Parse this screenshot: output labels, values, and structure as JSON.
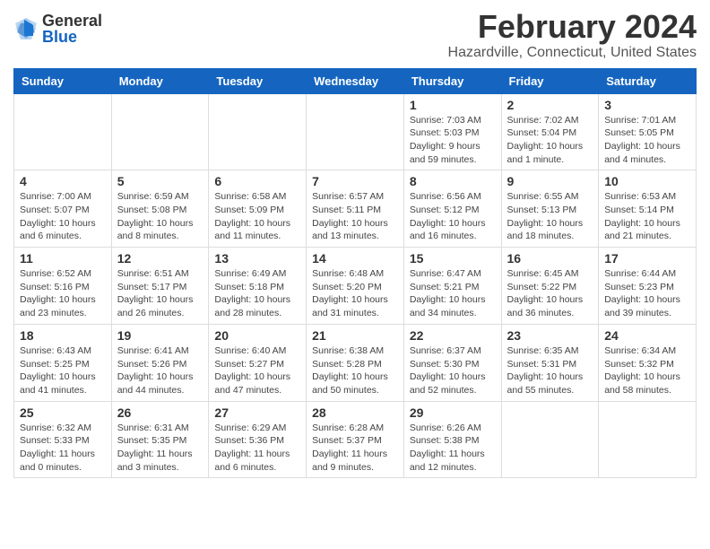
{
  "logo": {
    "general": "General",
    "blue": "Blue"
  },
  "title": "February 2024",
  "location": "Hazardville, Connecticut, United States",
  "days_of_week": [
    "Sunday",
    "Monday",
    "Tuesday",
    "Wednesday",
    "Thursday",
    "Friday",
    "Saturday"
  ],
  "weeks": [
    [
      {
        "day": "",
        "info": ""
      },
      {
        "day": "",
        "info": ""
      },
      {
        "day": "",
        "info": ""
      },
      {
        "day": "",
        "info": ""
      },
      {
        "day": "1",
        "info": "Sunrise: 7:03 AM\nSunset: 5:03 PM\nDaylight: 9 hours\nand 59 minutes."
      },
      {
        "day": "2",
        "info": "Sunrise: 7:02 AM\nSunset: 5:04 PM\nDaylight: 10 hours\nand 1 minute."
      },
      {
        "day": "3",
        "info": "Sunrise: 7:01 AM\nSunset: 5:05 PM\nDaylight: 10 hours\nand 4 minutes."
      }
    ],
    [
      {
        "day": "4",
        "info": "Sunrise: 7:00 AM\nSunset: 5:07 PM\nDaylight: 10 hours\nand 6 minutes."
      },
      {
        "day": "5",
        "info": "Sunrise: 6:59 AM\nSunset: 5:08 PM\nDaylight: 10 hours\nand 8 minutes."
      },
      {
        "day": "6",
        "info": "Sunrise: 6:58 AM\nSunset: 5:09 PM\nDaylight: 10 hours\nand 11 minutes."
      },
      {
        "day": "7",
        "info": "Sunrise: 6:57 AM\nSunset: 5:11 PM\nDaylight: 10 hours\nand 13 minutes."
      },
      {
        "day": "8",
        "info": "Sunrise: 6:56 AM\nSunset: 5:12 PM\nDaylight: 10 hours\nand 16 minutes."
      },
      {
        "day": "9",
        "info": "Sunrise: 6:55 AM\nSunset: 5:13 PM\nDaylight: 10 hours\nand 18 minutes."
      },
      {
        "day": "10",
        "info": "Sunrise: 6:53 AM\nSunset: 5:14 PM\nDaylight: 10 hours\nand 21 minutes."
      }
    ],
    [
      {
        "day": "11",
        "info": "Sunrise: 6:52 AM\nSunset: 5:16 PM\nDaylight: 10 hours\nand 23 minutes."
      },
      {
        "day": "12",
        "info": "Sunrise: 6:51 AM\nSunset: 5:17 PM\nDaylight: 10 hours\nand 26 minutes."
      },
      {
        "day": "13",
        "info": "Sunrise: 6:49 AM\nSunset: 5:18 PM\nDaylight: 10 hours\nand 28 minutes."
      },
      {
        "day": "14",
        "info": "Sunrise: 6:48 AM\nSunset: 5:20 PM\nDaylight: 10 hours\nand 31 minutes."
      },
      {
        "day": "15",
        "info": "Sunrise: 6:47 AM\nSunset: 5:21 PM\nDaylight: 10 hours\nand 34 minutes."
      },
      {
        "day": "16",
        "info": "Sunrise: 6:45 AM\nSunset: 5:22 PM\nDaylight: 10 hours\nand 36 minutes."
      },
      {
        "day": "17",
        "info": "Sunrise: 6:44 AM\nSunset: 5:23 PM\nDaylight: 10 hours\nand 39 minutes."
      }
    ],
    [
      {
        "day": "18",
        "info": "Sunrise: 6:43 AM\nSunset: 5:25 PM\nDaylight: 10 hours\nand 41 minutes."
      },
      {
        "day": "19",
        "info": "Sunrise: 6:41 AM\nSunset: 5:26 PM\nDaylight: 10 hours\nand 44 minutes."
      },
      {
        "day": "20",
        "info": "Sunrise: 6:40 AM\nSunset: 5:27 PM\nDaylight: 10 hours\nand 47 minutes."
      },
      {
        "day": "21",
        "info": "Sunrise: 6:38 AM\nSunset: 5:28 PM\nDaylight: 10 hours\nand 50 minutes."
      },
      {
        "day": "22",
        "info": "Sunrise: 6:37 AM\nSunset: 5:30 PM\nDaylight: 10 hours\nand 52 minutes."
      },
      {
        "day": "23",
        "info": "Sunrise: 6:35 AM\nSunset: 5:31 PM\nDaylight: 10 hours\nand 55 minutes."
      },
      {
        "day": "24",
        "info": "Sunrise: 6:34 AM\nSunset: 5:32 PM\nDaylight: 10 hours\nand 58 minutes."
      }
    ],
    [
      {
        "day": "25",
        "info": "Sunrise: 6:32 AM\nSunset: 5:33 PM\nDaylight: 11 hours\nand 0 minutes."
      },
      {
        "day": "26",
        "info": "Sunrise: 6:31 AM\nSunset: 5:35 PM\nDaylight: 11 hours\nand 3 minutes."
      },
      {
        "day": "27",
        "info": "Sunrise: 6:29 AM\nSunset: 5:36 PM\nDaylight: 11 hours\nand 6 minutes."
      },
      {
        "day": "28",
        "info": "Sunrise: 6:28 AM\nSunset: 5:37 PM\nDaylight: 11 hours\nand 9 minutes."
      },
      {
        "day": "29",
        "info": "Sunrise: 6:26 AM\nSunset: 5:38 PM\nDaylight: 11 hours\nand 12 minutes."
      },
      {
        "day": "",
        "info": ""
      },
      {
        "day": "",
        "info": ""
      }
    ]
  ]
}
